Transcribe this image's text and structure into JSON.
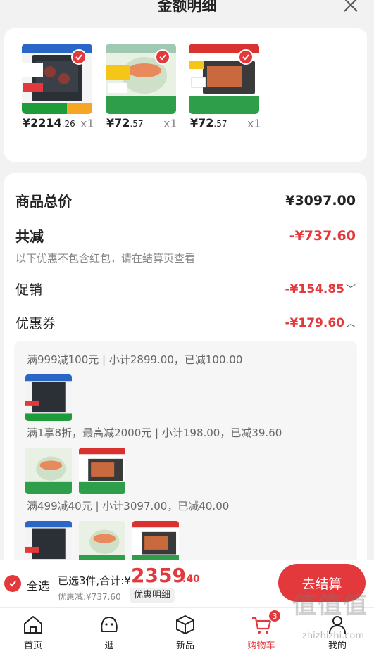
{
  "header": {
    "title": "金额明细"
  },
  "products": [
    {
      "price_int": "¥2214",
      "price_dec": ".26",
      "qty": "x1"
    },
    {
      "price_int": "¥72",
      "price_dec": ".57",
      "qty": "x1"
    },
    {
      "price_int": "¥72",
      "price_dec": ".57",
      "qty": "x1"
    }
  ],
  "summary": {
    "total_label": "商品总价",
    "total_value": "¥3097.00",
    "reduce_label": "共减",
    "reduce_value": "-¥737.60",
    "note": "以下优惠不包含红包，请在结算页查看",
    "promo_label": "促销",
    "promo_value": "-¥154.85",
    "coupon_label": "优惠券",
    "coupon_value": "-¥179.60"
  },
  "coupons": [
    {
      "text": "满999减100元 | 小计2899.00，已减100.00"
    },
    {
      "text": "满1享8折，最高减2000元 | 小计198.00，已减39.60"
    },
    {
      "text": "满499减40元 | 小计3097.00，已减40.00"
    }
  ],
  "checkout": {
    "select_all": "全选",
    "selected_text": "已选3件,合计:¥",
    "total_int": "2359",
    "total_dec": ".40",
    "discount_text": "优惠减:¥737.60",
    "detail_btn": "优惠明细",
    "go_btn": "去结算"
  },
  "tabs": [
    {
      "label": "首页",
      "icon": "home-icon"
    },
    {
      "label": "逛",
      "icon": "face-icon"
    },
    {
      "label": "新品",
      "icon": "cube-icon"
    },
    {
      "label": "购物车",
      "icon": "cart-icon",
      "badge": "3"
    },
    {
      "label": "我的",
      "icon": "user-icon"
    }
  ],
  "watermark": {
    "main": "值值值",
    "sub": "zhizhizhi.com"
  },
  "colors": {
    "accent": "#e4393c",
    "background": "#f2f2f2"
  }
}
